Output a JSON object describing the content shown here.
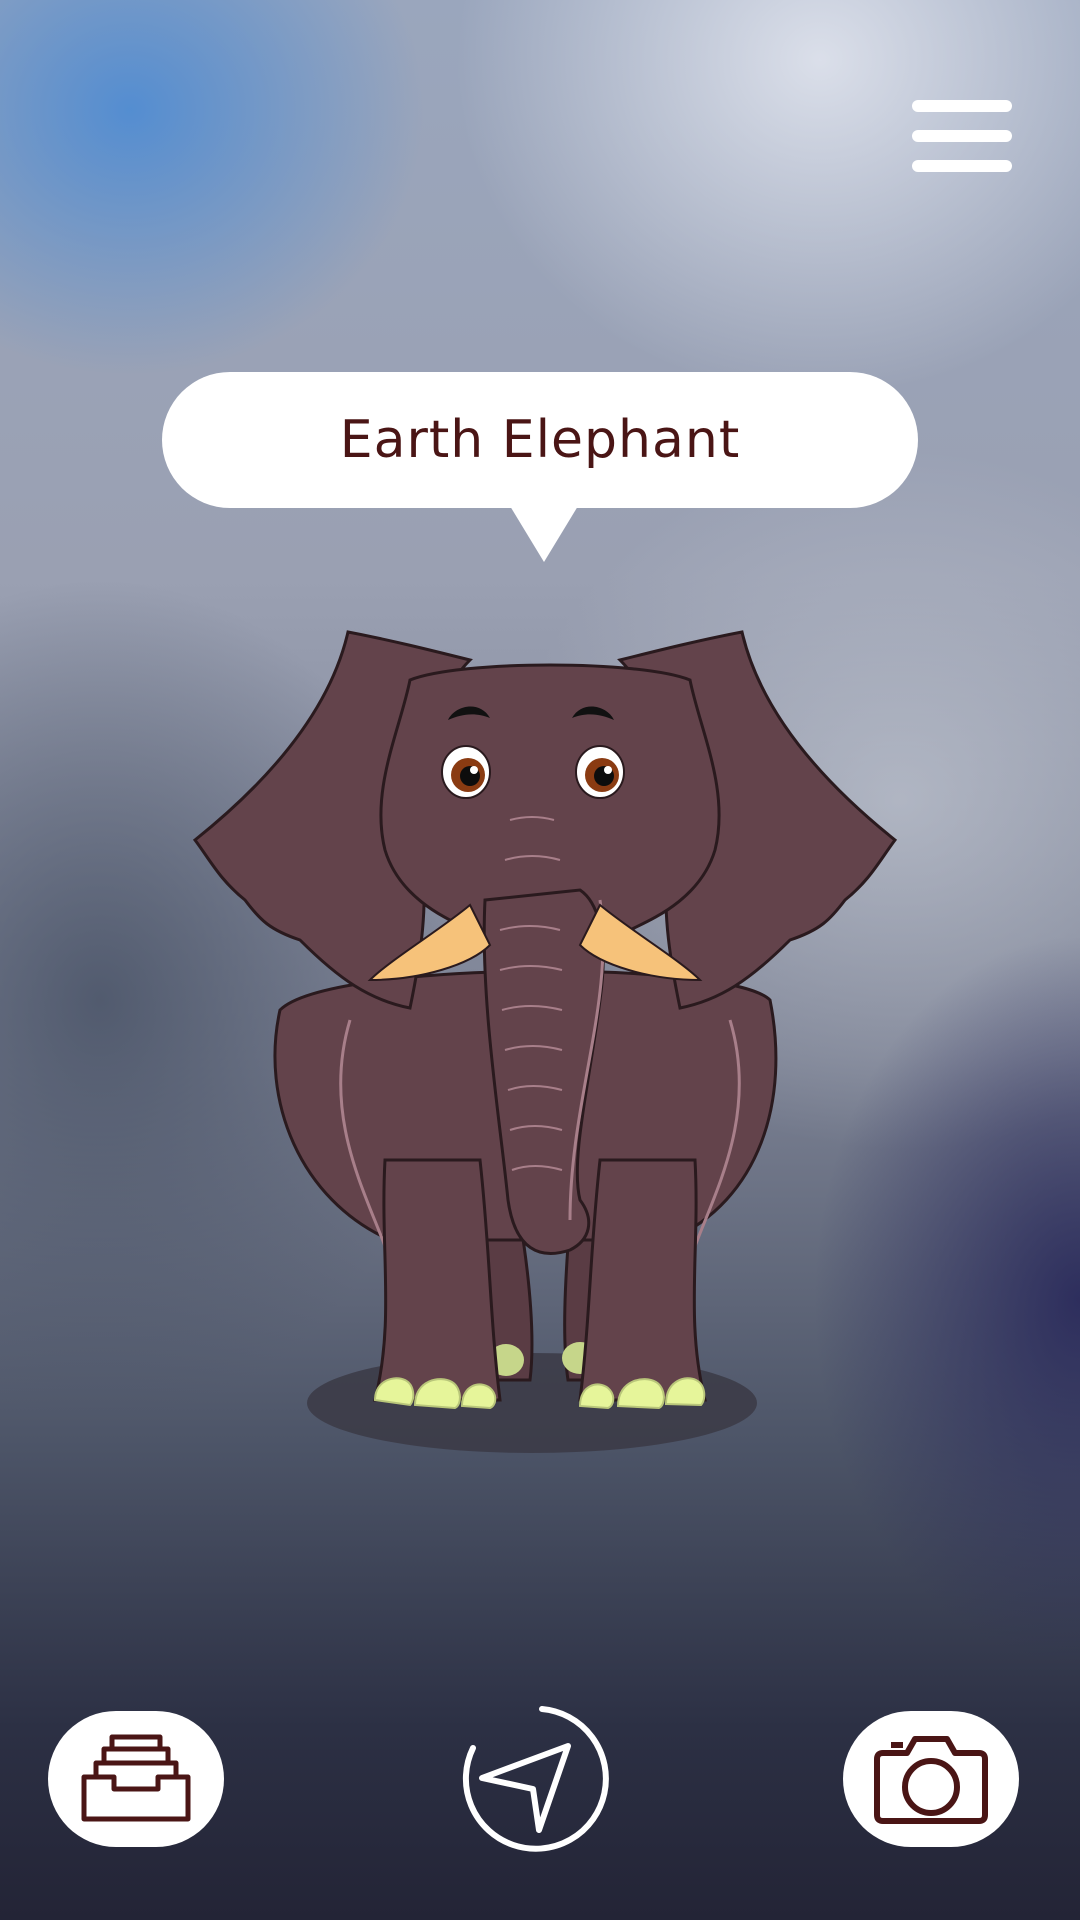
{
  "header": {
    "menu_icon": "hamburger-menu-icon"
  },
  "animal": {
    "name": "Earth Elephant",
    "illustration": "cartoon-elephant"
  },
  "toolbar": {
    "left_icon": "inbox-tray-icon",
    "center_icon": "navigation-arrow-icon",
    "right_icon": "camera-icon"
  },
  "colors": {
    "accent": "#4a1515",
    "elephant_body": "#63434b",
    "tusk": "#f6c27a",
    "toenails": "#e6f59a"
  }
}
